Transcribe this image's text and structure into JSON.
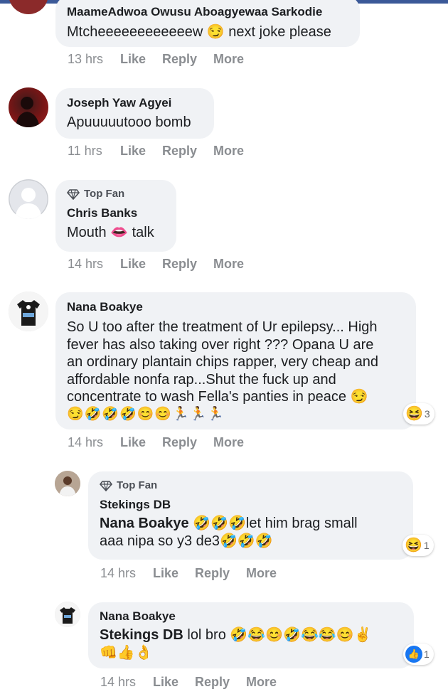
{
  "comments": [
    {
      "name": "MaameAdwoa Owusu Aboagyewaa Sarkodie",
      "text": "Mtcheeeeeeeeeeeew 😏 next joke please",
      "time": "13 hrs",
      "like": "Like",
      "reply": "Reply",
      "more": "More"
    },
    {
      "name": "Joseph Yaw Agyei",
      "text": "Apuuuuutooo bomb",
      "time": "11 hrs",
      "like": "Like",
      "reply": "Reply",
      "more": "More"
    },
    {
      "badge": "Top Fan",
      "name": "Chris Banks",
      "text": "Mouth 👄 talk",
      "time": "14 hrs",
      "like": "Like",
      "reply": "Reply",
      "more": "More"
    },
    {
      "name": "Nana Boakye",
      "lines": [
        "So U too after the treatment of Ur epilepsy... High",
        "fever has also taking over right ??? Opana U are",
        "an ordinary plantain chips rapper, very cheap and",
        "affordable nonfa rap...Shut the fuck up and",
        "concentrate to wash Fella's panties in peace 😏"
      ],
      "emoji_line": "😏🤣🤣🤣😊😊🏃🏃🏃",
      "reaction_icon": "😆",
      "reaction_count": "3",
      "time": "14 hrs",
      "like": "Like",
      "reply": "Reply",
      "more": "More"
    }
  ],
  "replies": [
    {
      "badge": "Top Fan",
      "name": "Stekings DB",
      "tag": "Nana Boakye",
      "line1": "🤣🤣🤣let him brag small",
      "line2": "aaa nipa so y3 de3🤣🤣🤣",
      "reaction_icon": "😆",
      "reaction_count": "1",
      "time": "14 hrs",
      "like": "Like",
      "reply": "Reply",
      "more": "More"
    },
    {
      "name": "Nana Boakye",
      "tag": "Stekings DB",
      "line1": " lol bro 🤣😂😊🤣😂😂😊✌️",
      "line2": "👊👍👌",
      "reaction_icon": "👍",
      "reaction_count": "1",
      "time": "14 hrs",
      "like": "Like",
      "reply": "Reply",
      "more": "More"
    }
  ],
  "colors": {
    "bubble": "#f0f2f5",
    "meta": "#8a8d91",
    "like_blue": "#1877f2",
    "topbar": "#3b5998"
  },
  "icons": {
    "top_fan": "diamond-icon"
  }
}
